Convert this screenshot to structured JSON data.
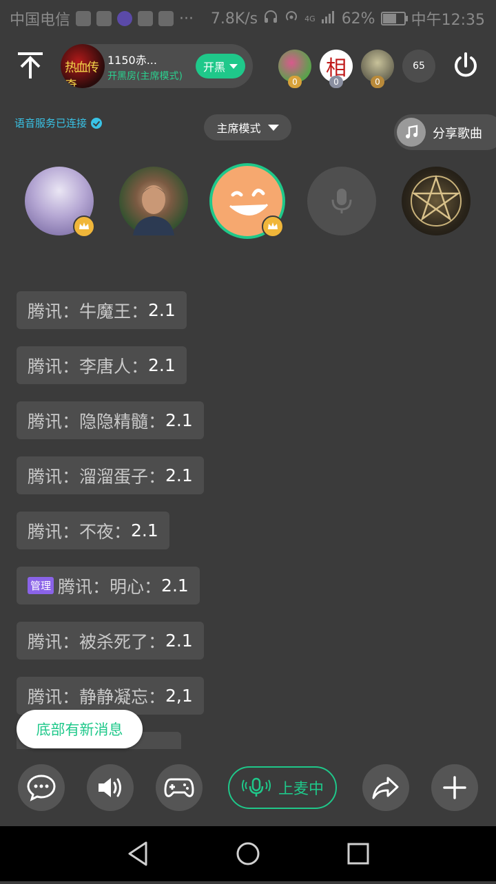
{
  "status_bar": {
    "carrier": "中国电信",
    "net_speed": "7.8K/s",
    "network": "4G",
    "battery": "62%",
    "time": "中午12:35"
  },
  "room": {
    "title": "1150赤...",
    "mode_label": "开黑房(主席模式)",
    "action_label": "开黑",
    "avatar_text": "热血传奇"
  },
  "viewers": [
    {
      "badge": "0",
      "badge_color": "#d8a23a"
    },
    {
      "char": "相",
      "badge": "0",
      "badge_color": "#8a8fa0"
    },
    {
      "badge": "0",
      "badge_color": "#b98a3a"
    }
  ],
  "viewer_count": "65",
  "voice_status": "语音服务已连接",
  "mode_select": "主席模式",
  "share_song": "分享歌曲",
  "messages": [
    {
      "source": "腾讯：",
      "name": "牛魔王：",
      "value": "2.1"
    },
    {
      "source": "腾讯：",
      "name": "李唐人：",
      "value": "2.1"
    },
    {
      "source": "腾讯：",
      "name": "隐隐精髓：",
      "value": "2.1"
    },
    {
      "source": "腾讯：",
      "name": "溜溜蛋子：",
      "value": "2.1"
    },
    {
      "source": "腾讯：",
      "name": "不夜：",
      "value": "2.1"
    },
    {
      "tag": "管理",
      "source": "腾讯：",
      "name": "明心：",
      "value": "2.1"
    },
    {
      "source": "腾讯：",
      "name": "被杀死了：",
      "value": "2.1"
    },
    {
      "source": "腾讯：",
      "name": "静静凝忘：",
      "value": "2,1"
    }
  ],
  "new_message_hint": "底部有新消息",
  "toolbar": {
    "mic_live_label": "上麦中"
  },
  "colors": {
    "accent": "#1fc88a",
    "background": "#3b3b3b",
    "admin_tag": "#8a63e8",
    "link": "#39c3e6"
  }
}
